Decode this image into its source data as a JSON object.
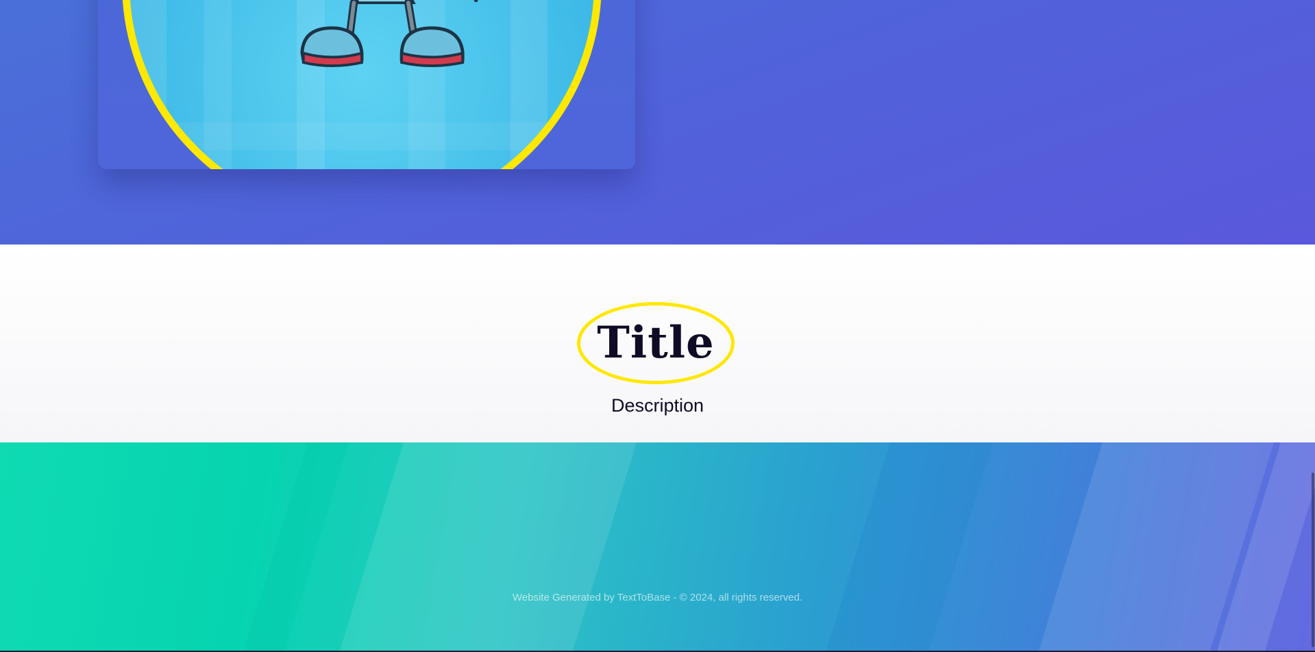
{
  "hero": {
    "image": {
      "icon": "robot-mascot",
      "ring_color": "#ffe800"
    }
  },
  "section": {
    "title": "Title",
    "description": "Description",
    "highlight_color": "#ffe800"
  },
  "footer": {
    "text": "Website Generated by TextToBase - © 2024, all rights reserved."
  },
  "colors": {
    "hero_gradient": [
      "#4a70d8",
      "#5a58dc"
    ],
    "footer_gradient": [
      "#0fdab2",
      "#6569e0"
    ],
    "title_color": "#0f0b26"
  }
}
